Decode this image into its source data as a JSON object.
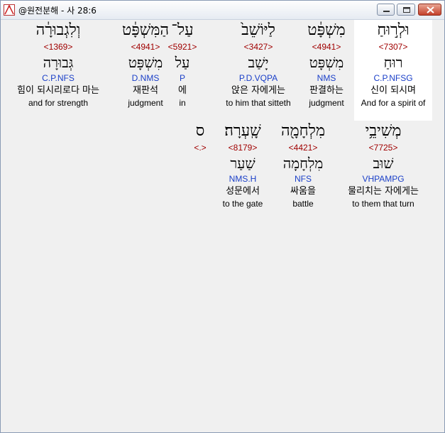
{
  "window": {
    "title": "@원전분해 - 사 28:6",
    "app_icon": "compass-icon"
  },
  "row1": [
    {
      "heb": "וּלְר֣וּחַ",
      "strong": "<7307>",
      "root": "רוּחַ",
      "parse": "C.P.NFSG",
      "kor": "신이 되시며",
      "eng": "And for a spirit of",
      "highlight": true
    },
    {
      "heb": "מִשְׁפָּ֔ט",
      "strong": "<4941>",
      "root": "מִשְׁפָּט",
      "parse": "NMS",
      "kor": "판결하는",
      "eng": "judgment",
      "highlight": false
    },
    {
      "heb": "לַיּוֹשֵׁב֙",
      "strong": "<3427>",
      "root": "יָשַׁב",
      "parse": "P.D.VQPA",
      "kor": "앉은 자에게는",
      "eng": "to him that sitteth",
      "highlight": false
    },
    {
      "heb": "עַל־",
      "strong": "<5921>",
      "root": "עַל",
      "parse": "P",
      "kor": "에",
      "eng": "in",
      "highlight": false
    },
    {
      "heb": "הַמִּשְׁפָּ֔ט",
      "strong": "<4941>",
      "root": "מִשְׁפָּט",
      "parse": "D.NMS",
      "kor": "재판석",
      "eng": "judgment",
      "highlight": false
    },
    {
      "heb": "וְלִגְבוּרָ֔ה",
      "strong": "<1369>",
      "root": "גְּבוּרָה",
      "parse": "C.P.NFS",
      "kor": "힘이 되시리로다 마는",
      "eng": "and for strength",
      "highlight": false
    }
  ],
  "row2": [
    {
      "heb": "מְשִׁיבֵ֥י",
      "strong": "<7725>",
      "root": "שׁוּב",
      "parse": "VHPAMPG",
      "kor": "물리치는 자에게는",
      "eng": "to them that turn"
    },
    {
      "heb": "מִלְחָמָ֖ה",
      "strong": "<4421>",
      "root": "מִלְחָמָה",
      "parse": "NFS",
      "kor": "싸움을",
      "eng": "battle"
    },
    {
      "heb": "שָֽׁעְרָה׃",
      "strong": "<8179>",
      "root": "שַׁעַר",
      "parse": "NMS.H",
      "kor": "성문에서",
      "eng": "to the gate"
    },
    {
      "heb": "ס",
      "strong": "<.>",
      "root": "",
      "parse": "",
      "kor": "",
      "eng": ""
    }
  ]
}
